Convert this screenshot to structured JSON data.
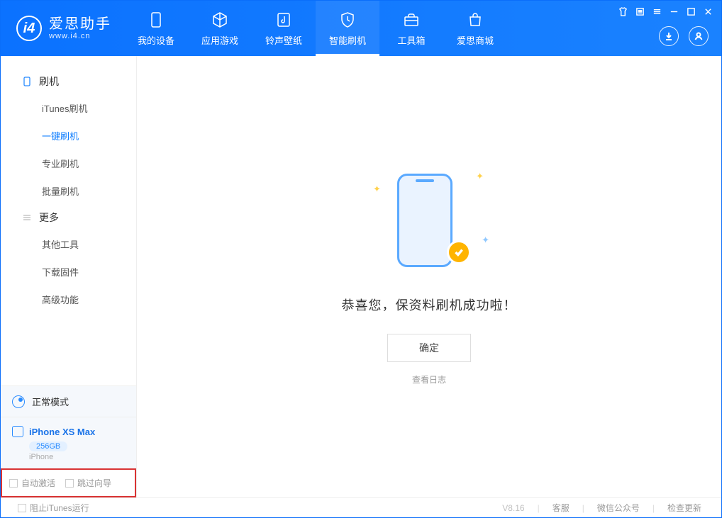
{
  "app": {
    "name_cn": "爱思助手",
    "url": "www.i4.cn"
  },
  "nav": [
    {
      "id": "device",
      "label": "我的设备"
    },
    {
      "id": "apps",
      "label": "应用游戏"
    },
    {
      "id": "ring",
      "label": "铃声壁纸"
    },
    {
      "id": "flash",
      "label": "智能刷机",
      "active": true
    },
    {
      "id": "tools",
      "label": "工具箱"
    },
    {
      "id": "store",
      "label": "爱思商城"
    }
  ],
  "sidebar": {
    "section1": "刷机",
    "items1": [
      {
        "label": "iTunes刷机"
      },
      {
        "label": "一键刷机",
        "active": true
      },
      {
        "label": "专业刷机"
      },
      {
        "label": "批量刷机"
      }
    ],
    "section2": "更多",
    "items2": [
      {
        "label": "其他工具"
      },
      {
        "label": "下载固件"
      },
      {
        "label": "高级功能"
      }
    ],
    "mode": "正常模式",
    "device": {
      "name": "iPhone XS Max",
      "capacity": "256GB",
      "sub": "iPhone"
    },
    "opts": {
      "auto": "自动激活",
      "skip": "跳过向导"
    }
  },
  "main": {
    "message": "恭喜您，保资料刷机成功啦！",
    "ok": "确定",
    "log": "查看日志"
  },
  "footer": {
    "block_itunes": "阻止iTunes运行",
    "version": "V8.16",
    "service": "客服",
    "wechat": "微信公众号",
    "update": "检查更新"
  }
}
